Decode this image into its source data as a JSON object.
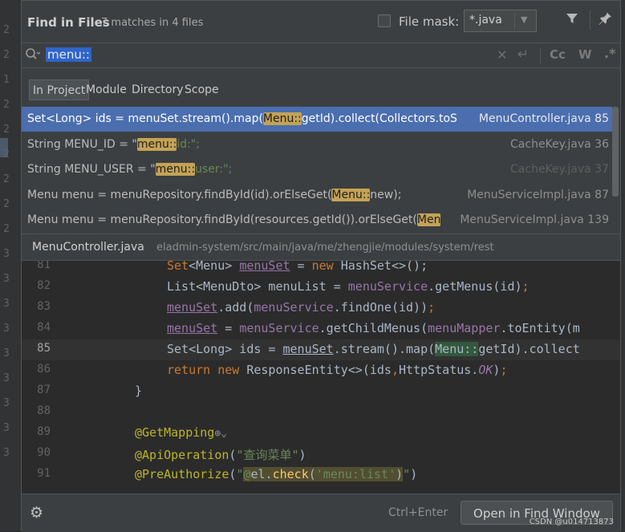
{
  "popup": {
    "title": "Find in Files",
    "match_summary": "7 matches in 4 files",
    "file_mask_label": "File mask:",
    "file_mask_value": "*.java"
  },
  "search": {
    "query": "menu::",
    "case_icon": "Cc",
    "word_icon": "W",
    "regex_icon": ".*"
  },
  "scopes": [
    "In Project",
    "Module",
    "Directory",
    "Scope"
  ],
  "results": [
    {
      "code_before": "Set<Long> ids = menuSet.stream().map(",
      "match": "Menu::",
      "code_after": "getId).collect(Collectors.toS",
      "file": "MenuController.java 85",
      "selected": true
    },
    {
      "code_before": "String MENU_ID = \"",
      "match": "menu::",
      "code_after": "id:\";",
      "file": "CacheKey.java 36",
      "selected": false
    },
    {
      "code_before": "String MENU_USER = \"",
      "match": "menu::",
      "code_after": "user:\";",
      "file": "CacheKey.java 37",
      "selected": false
    },
    {
      "code_before": "Menu menu = menuRepository.findById(id).orElseGet(",
      "match": "Menu::",
      "code_after": "new);",
      "file": "MenuServiceImpl.java 87",
      "selected": false
    },
    {
      "code_before": "Menu menu = menuRepository.findById(resources.getId()).orElseGet(",
      "match": "Men",
      "code_after": "",
      "file": "MenuServiceImpl.java 139",
      "selected": false
    }
  ],
  "preview": {
    "file_name": "MenuController.java",
    "file_path": "eladmin-system/src/main/java/me/zhengjie/modules/system/rest",
    "line_numbers": [
      "81",
      "82",
      "83",
      "84",
      "85",
      "86",
      "87",
      "88",
      "89",
      "90",
      "91"
    ],
    "current_line": "85",
    "annotation_text": "查询菜单",
    "preauthorize_text": "menu:list"
  },
  "footer": {
    "shortcut": "Ctrl+Enter",
    "open_button": "Open in Find Window"
  },
  "watermark": "CSDN @u014713873",
  "left_gutter_numbers": [
    "2",
    "2",
    "1",
    "2",
    "2",
    "2",
    "2",
    "2",
    "2",
    "3",
    "3",
    "3",
    "3",
    "3",
    "3",
    "3",
    "3",
    "3"
  ]
}
